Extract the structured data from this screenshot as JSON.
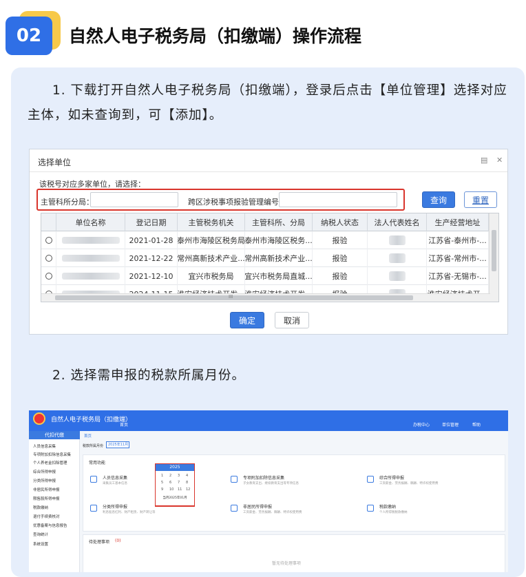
{
  "header": {
    "badge": "02",
    "title": "自然人电子税务局（扣缴端）操作流程"
  },
  "step1": {
    "text": "1. 下载打开自然人电子税务局（扣缴端），登录后点击【单位管理】选择对应主体，如未查询到，可【添加】。"
  },
  "step2": {
    "text": "2. 选择需申报的税款所属月份。"
  },
  "dialog": {
    "title": "选择单位",
    "prompt": "该税号对应多家单位，请选择：",
    "field1_label": "主管科所分局：",
    "field2_label": "跨区涉税事项报验管理编号：",
    "query_button": "查询",
    "reset_button": "重置",
    "confirm_button": "确定",
    "cancel_button": "取消",
    "h_scroll_mark": "III",
    "columns": [
      "单位名称",
      "登记日期",
      "主管税务机关",
      "主管科所、分局",
      "纳税人状态",
      "法人代表姓名",
      "生产经营地址"
    ],
    "rows": [
      {
        "date": "2021-01-28",
        "authority": "泰州市海陵区税务局",
        "branch": "泰州市海陵区税务...",
        "status": "报验",
        "address": "江苏省-泰州市-..."
      },
      {
        "date": "2021-12-22",
        "authority": "常州高新技术产业...",
        "branch": "常州高新技术产业...",
        "status": "报验",
        "address": "江苏省-常州市-..."
      },
      {
        "date": "2021-12-10",
        "authority": "宜兴市税务局",
        "branch": "宜兴市税务局直城...",
        "status": "报验",
        "address": "江苏省-无锡市-..."
      },
      {
        "date": "2024-11-15",
        "authority": "淮安经济技术开发...",
        "branch": "淮安经济技术开发...",
        "status": "报验",
        "address": "淮安经济技术开..."
      }
    ]
  },
  "app": {
    "name": "自然人电子税务局（扣缴端）",
    "nav": [
      "首页",
      "办税中心",
      "单位管理",
      "帮助"
    ],
    "sidebar_title": "代扣代缴",
    "sidebar_items": [
      "人员信息采集",
      "专项附加扣除信息采集",
      "个人养老金扣除管理",
      "综合所得申报",
      "分类所得申报",
      "非居民所得申报",
      "限售股所得申报",
      "税款缴纳",
      "退付手续费核对",
      "优惠备案与信息报告",
      "查询统计",
      "系统设置"
    ],
    "breadcrumb": "首页",
    "period_label": "税款所属月份",
    "period_value": "2025年11月",
    "cal_year": "2025",
    "cal_months": [
      "1",
      "2",
      "3",
      "4",
      "5",
      "6",
      "7",
      "8",
      "9",
      "10",
      "11",
      "12"
    ],
    "cal_footer": "当月2025年01月",
    "section_common": "常用功能",
    "tiles": [
      {
        "title": "人员信息采集",
        "sub": "采集员工基本信息"
      },
      {
        "title": "专项附加扣除信息采集",
        "sub": "子女教育支出、继续教育支出等专项信息"
      },
      {
        "title": "综合所得申报",
        "sub": "工资薪金、劳务报酬、稿酬、特许权使用费"
      },
      {
        "title": "分类所得申报",
        "sub": "利息股息红利、财产租赁、财产转让等"
      },
      {
        "title": "非居民所得申报",
        "sub": "工资薪金、劳务报酬、稿酬、特许权使用费"
      },
      {
        "title": "税款缴纳",
        "sub": "个人所得税税款缴纳"
      }
    ],
    "todo_title": "待处理事项",
    "todo_count": "(0)",
    "empty_text": "暂无待处理事项"
  }
}
